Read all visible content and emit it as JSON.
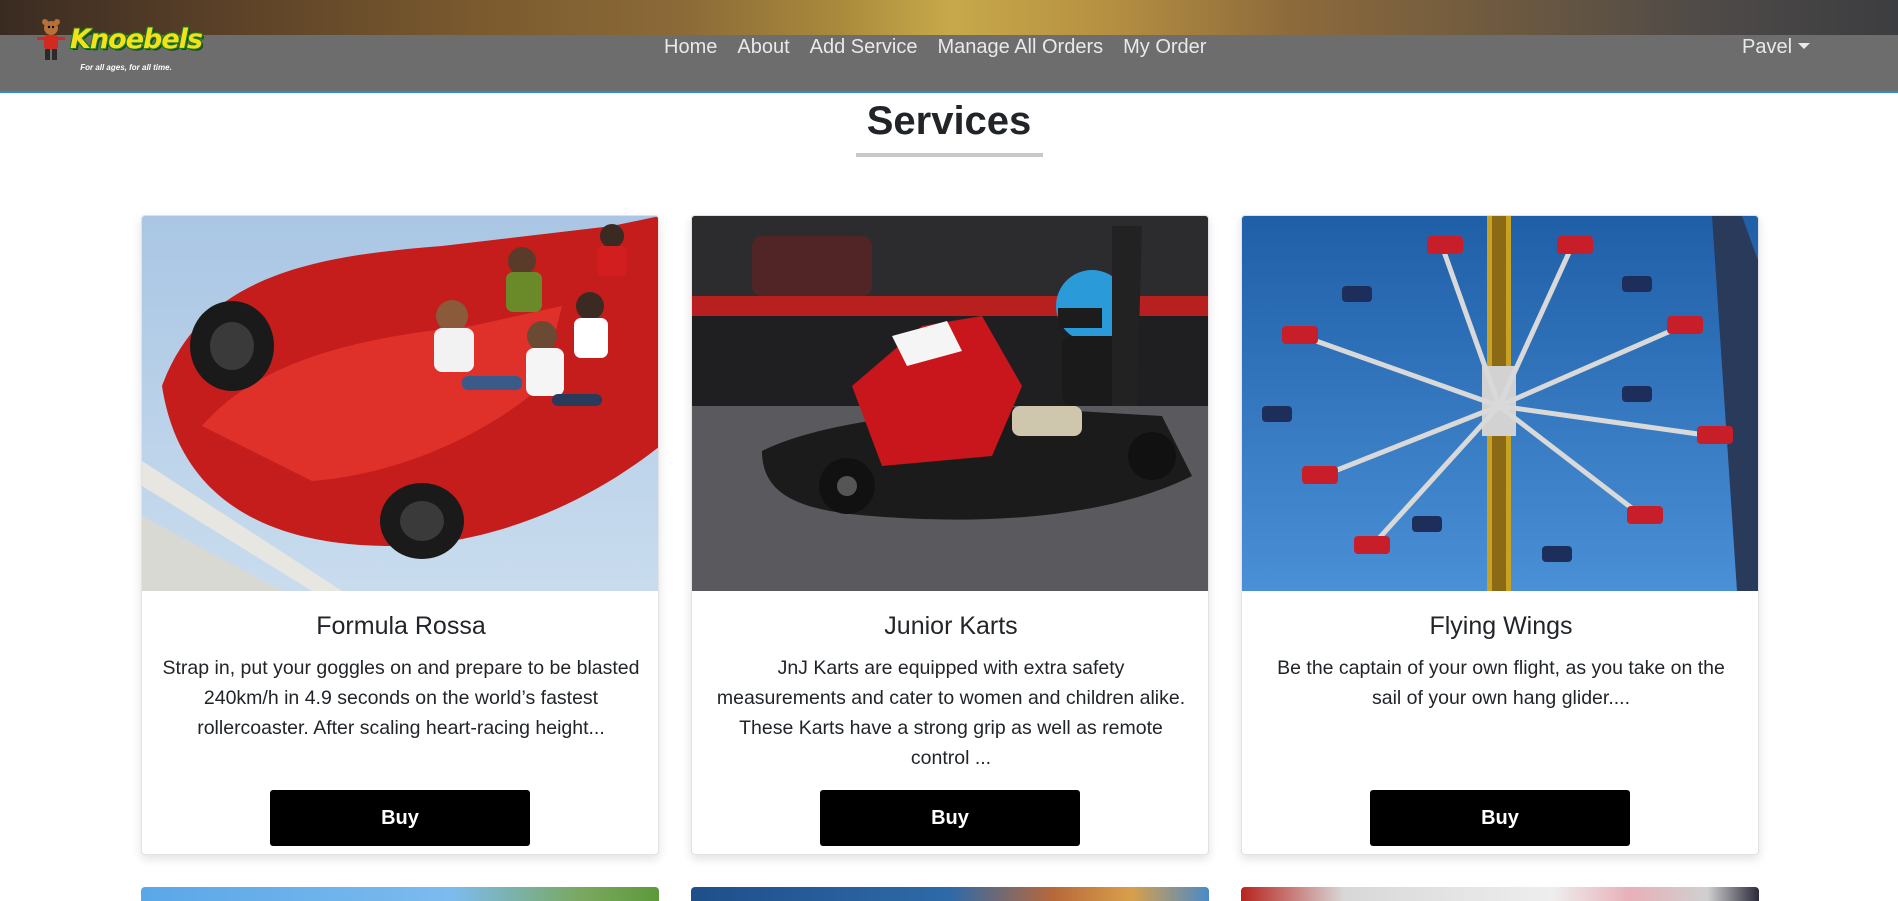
{
  "brand": {
    "name": "Knoebels",
    "tagline": "For all ages, for all time."
  },
  "nav": {
    "links": [
      "Home",
      "About",
      "Add Service",
      "Manage All Orders",
      "My Order"
    ],
    "user": "Pavel"
  },
  "page": {
    "title": "Services"
  },
  "services": [
    {
      "title": "Formula Rossa",
      "description": "Strap in, put your goggles on and prepare to be blasted 240km/h in 4.9 seconds on the world’s fastest rollercoaster. After scaling heart-racing height...",
      "button": "Buy"
    },
    {
      "title": "Junior Karts",
      "description": "JnJ Karts are equipped with extra safety measurements and cater to women and children alike. These Karts have a strong grip as well as remote control ...",
      "button": "Buy"
    },
    {
      "title": "Flying Wings",
      "description": "Be the captain of your own flight, as you take on the sail of your own hang glider....",
      "button": "Buy"
    }
  ],
  "colors": {
    "navbar": "#6d6d6d",
    "nav_accent": "#2f8bd8",
    "button": "#000000"
  }
}
